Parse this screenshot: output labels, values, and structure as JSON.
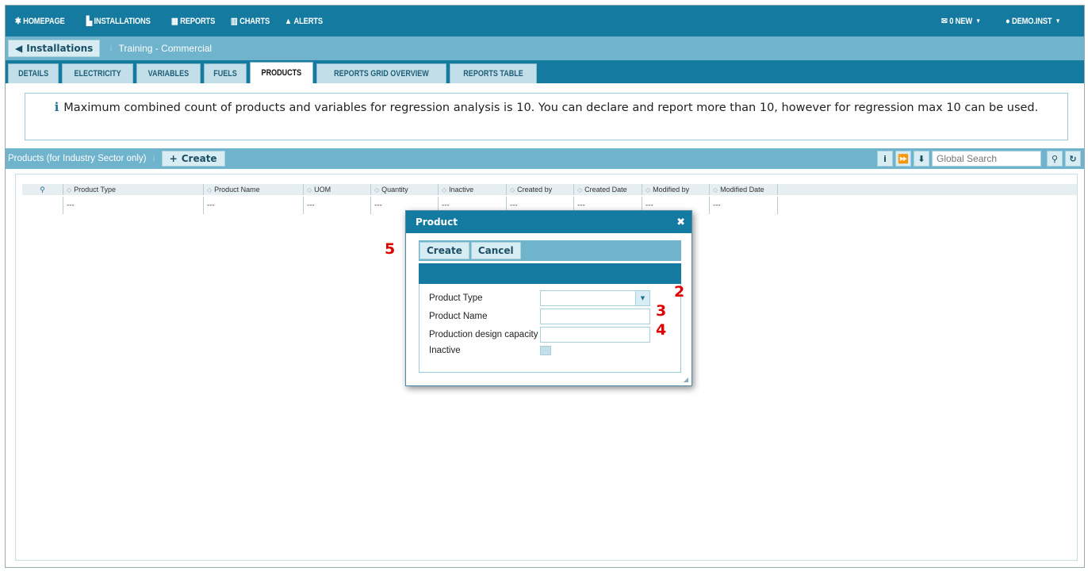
{
  "nav": {
    "items": [
      {
        "icon": "home-icon",
        "glyph": "⌂",
        "label": "HOMEPAGE"
      },
      {
        "icon": "factory-icon",
        "glyph": "▙",
        "label": "INSTALLATIONS"
      },
      {
        "icon": "calendar-icon",
        "glyph": "▦",
        "label": "REPORTS"
      },
      {
        "icon": "chart-icon",
        "glyph": "▥",
        "label": "CHARTS"
      },
      {
        "icon": "warning-icon",
        "glyph": "▲",
        "label": "ALERTS"
      }
    ],
    "messages_label": "0 NEW",
    "user_label": "DEMO.INST"
  },
  "breadcrumb": {
    "back_label": "Installations",
    "current": "Training - Commercial"
  },
  "tabs": [
    {
      "label": "DETAILS",
      "active": false
    },
    {
      "label": "ELECTRICITY",
      "active": false
    },
    {
      "label": "VARIABLES",
      "active": false
    },
    {
      "label": "FUELS",
      "active": false
    },
    {
      "label": "PRODUCTS",
      "active": true
    },
    {
      "label": "REPORTS GRID OVERVIEW",
      "active": false
    },
    {
      "label": "REPORTS TABLE",
      "active": false
    }
  ],
  "info": {
    "text": "Maximum combined count of products and variables for regression analysis is 10. You can declare and report more than 10, however for regression max 10 can be used."
  },
  "grid": {
    "title": "Products (for Industry Sector only)",
    "create_label": "Create",
    "search_placeholder": "Global Search",
    "columns": [
      "Product Type",
      "Product Name",
      "UOM",
      "Quantity",
      "Inactive",
      "Created by",
      "Created Date",
      "Modified by",
      "Modified Date"
    ],
    "row": [
      "---",
      "---",
      "---",
      "---",
      "---",
      "---",
      "---",
      "---",
      "---"
    ]
  },
  "modal": {
    "title": "Product",
    "create_label": "Create",
    "cancel_label": "Cancel",
    "fields": {
      "product_type_label": "Product Type",
      "product_name_label": "Product Name",
      "capacity_label": "Production design capacity",
      "inactive_label": "Inactive"
    }
  },
  "markers": {
    "m2": "2",
    "m3": "3",
    "m4": "4",
    "m5": "5"
  }
}
